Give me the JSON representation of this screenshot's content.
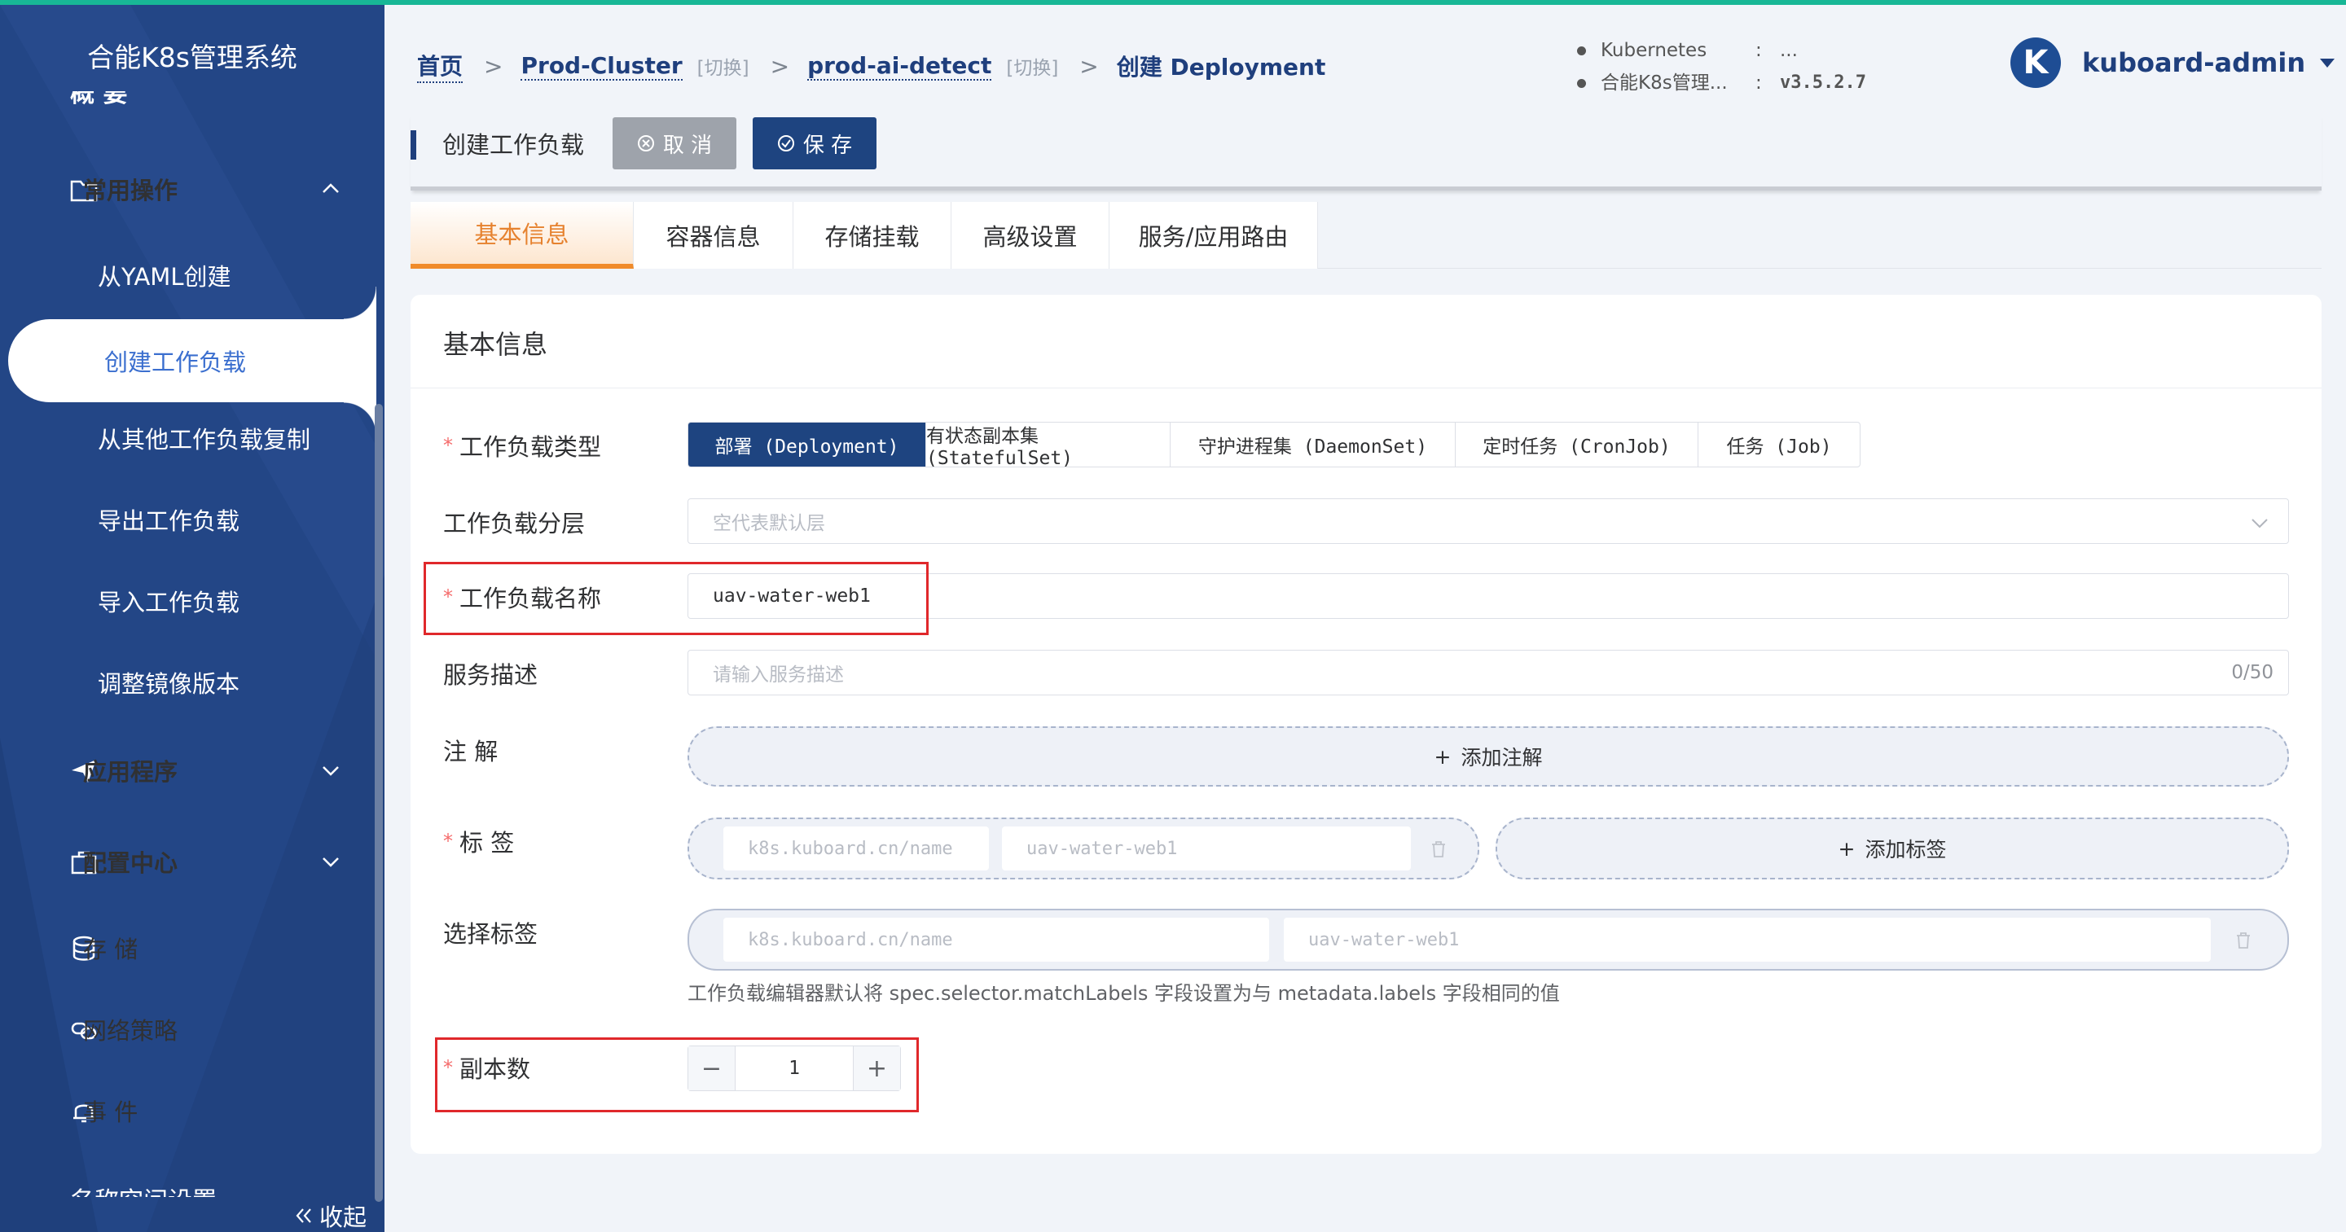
{
  "sidebar": {
    "title": "合能K8s管理系统",
    "partial_top": "概 要",
    "items": [
      {
        "label": "常用操作"
      },
      {
        "label": "从YAML创建"
      },
      {
        "label": "创建工作负载"
      },
      {
        "label": "从其他工作负载复制"
      },
      {
        "label": "导出工作负载"
      },
      {
        "label": "导入工作负载"
      },
      {
        "label": "调整镜像版本"
      },
      {
        "label": "应用程序"
      },
      {
        "label": "配置中心"
      },
      {
        "label": "存 储"
      },
      {
        "label": "网络策略"
      },
      {
        "label": "事 件"
      },
      {
        "label": "名称空间设置"
      }
    ],
    "collapse": "收起"
  },
  "breadcrumb": {
    "home": "首页",
    "cluster": "Prod-Cluster",
    "cluster_switch": "[切换]",
    "namespace": "prod-ai-detect",
    "namespace_switch": "[切换]",
    "current": "创建 Deployment"
  },
  "version": {
    "k8s_label": "Kubernetes",
    "k8s_sep": ":",
    "k8s_value": "...",
    "app_label": "合能K8s管理...",
    "app_sep": ":",
    "app_value": "v3.5.2.7"
  },
  "user": {
    "initial": "K",
    "name": "kuboard-admin"
  },
  "toolbar": {
    "title": "创建工作负载",
    "cancel": "取 消",
    "save": "保 存"
  },
  "tabs": [
    "基本信息",
    "容器信息",
    "存储挂载",
    "高级设置",
    "服务/应用路由"
  ],
  "form": {
    "section_title": "基本信息",
    "type_label": "工作负载类型",
    "types": [
      "部署 (Deployment)",
      "有状态副本集 (StatefulSet)",
      "守护进程集 (DaemonSet)",
      "定时任务 (CronJob)",
      "任务 (Job)"
    ],
    "layer_label": "工作负载分层",
    "layer_placeholder": "空代表默认层",
    "name_label": "工作负载名称",
    "name_value": "uav-water-web1",
    "desc_label": "服务描述",
    "desc_placeholder": "请输入服务描述",
    "desc_count": "0/50",
    "annotation_label": "注 解",
    "add_annotation": "添加注解",
    "labels_label": "标 签",
    "label_key": "k8s.kuboard.cn/name",
    "label_value": "uav-water-web1",
    "add_label": "添加标签",
    "selector_label": "选择标签",
    "selector_key": "k8s.kuboard.cn/name",
    "selector_value": "uav-water-web1",
    "selector_hint": "工作负载编辑器默认将 spec.selector.matchLabels 字段设置为与 metadata.labels 字段相同的值",
    "replicas_label": "副本数",
    "replicas_value": "1",
    "minus": "−",
    "plus": "+"
  },
  "colors": {
    "sidebar": "#234686",
    "accent": "#1e4480",
    "tab_active": "#f08b2a",
    "highlight": "#e0282b",
    "topline": "#18b796"
  }
}
